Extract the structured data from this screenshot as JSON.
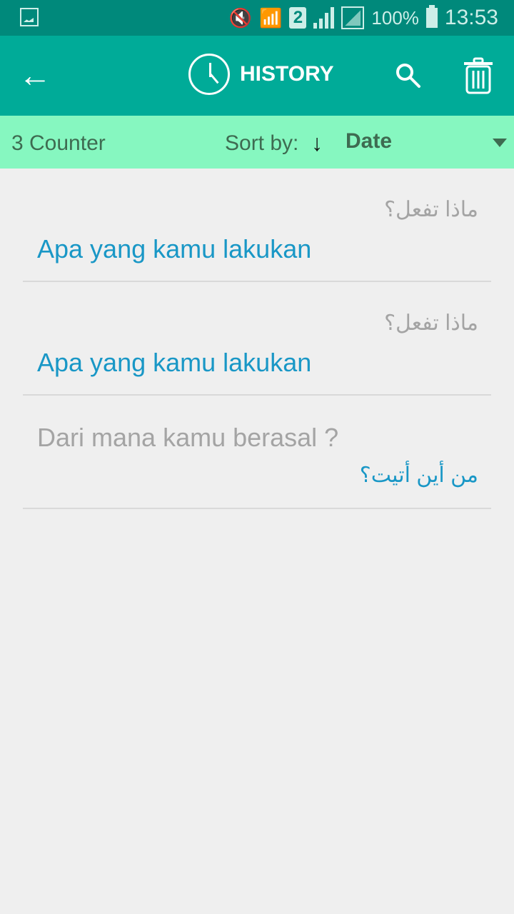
{
  "status_bar": {
    "icons": [
      "gallery-icon",
      "vibrate-mute-icon",
      "wifi-icon",
      "sim-2-icon",
      "signal-icon",
      "signal-icon-2",
      "battery-icon"
    ],
    "sim": "2",
    "battery": "100%",
    "time": "13:53"
  },
  "app_bar": {
    "back_icon": "←",
    "title": "HISTORY"
  },
  "sort_bar": {
    "counter": "3 Counter",
    "sort_label": "Sort by:",
    "sort_direction": "↓",
    "sort_value": "Date"
  },
  "history": [
    {
      "source": "ماذا تفعل؟",
      "translation": "Apa yang kamu lakukan",
      "source_lang": "ar"
    },
    {
      "source": "ماذا تفعل؟",
      "translation": "Apa yang kamu lakukan",
      "source_lang": "ar"
    },
    {
      "source": "Dari mana kamu berasal ?",
      "translation": "من أين أتيت؟",
      "source_lang": "id"
    }
  ]
}
